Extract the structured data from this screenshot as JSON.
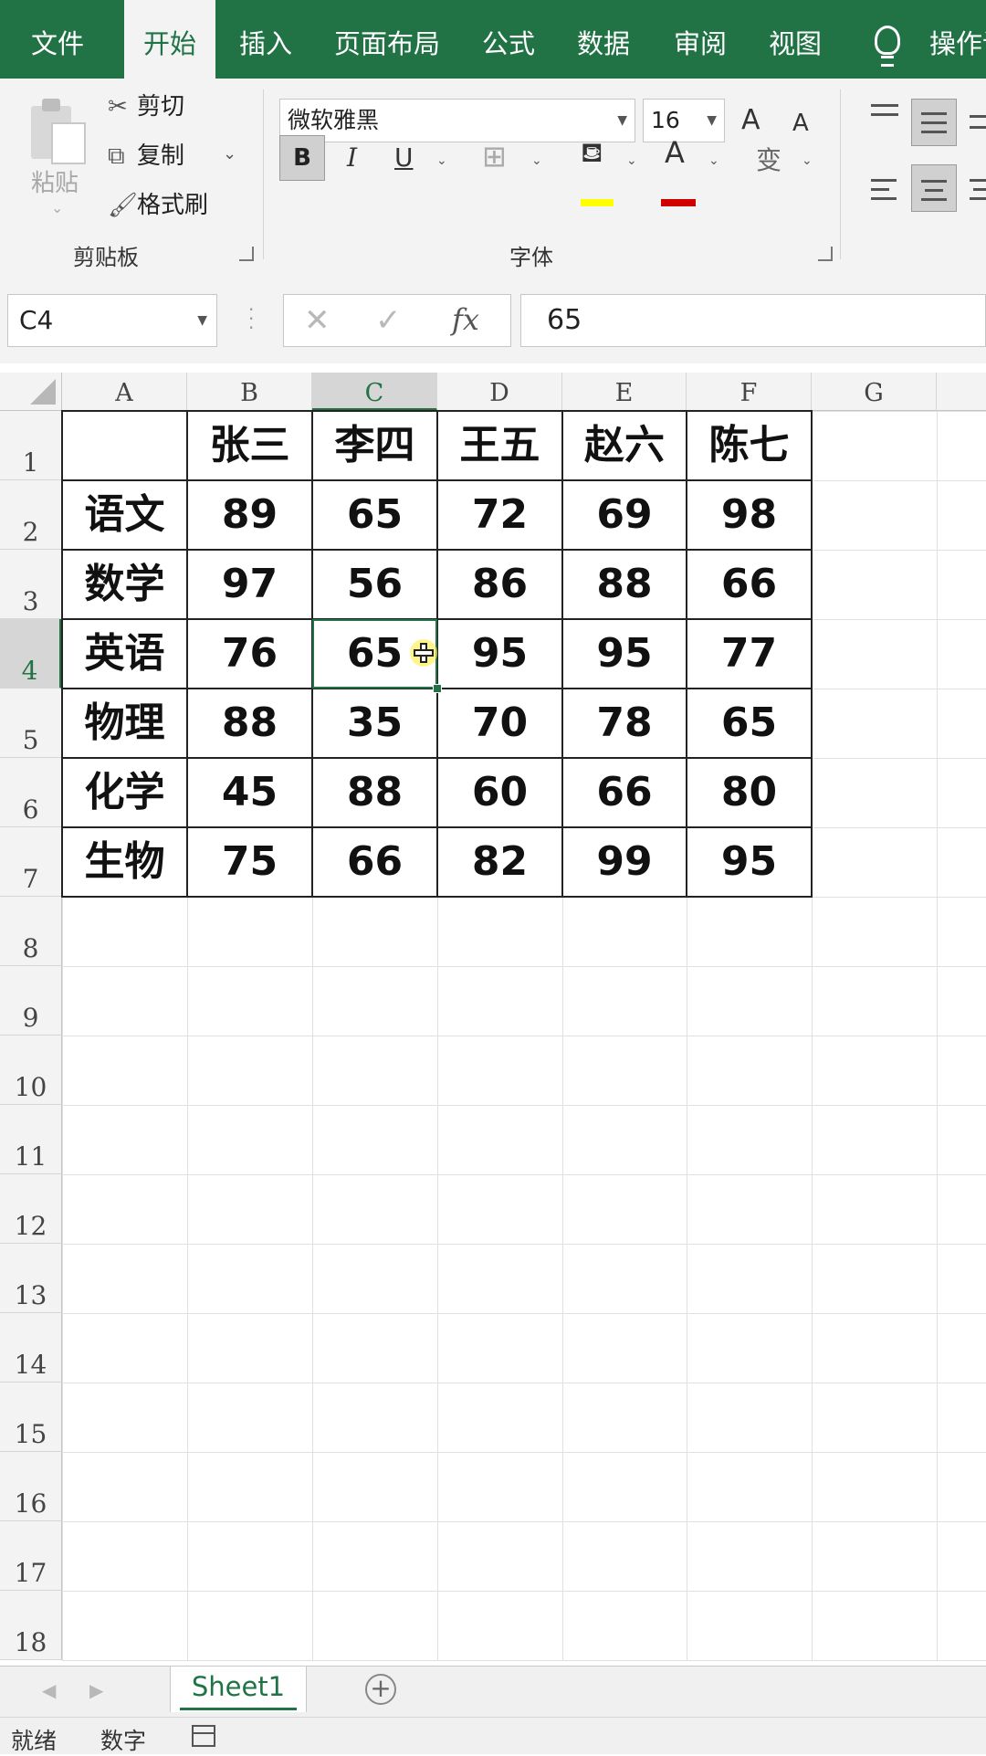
{
  "tabs": [
    "文件",
    "开始",
    "插入",
    "页面布局",
    "公式",
    "数据",
    "审阅",
    "视图"
  ],
  "active_tab": "开始",
  "tell_me": "操作说",
  "clipboard": {
    "paste": "粘贴",
    "cut": "剪切",
    "copy": "复制",
    "format_painter": "格式刷",
    "group_label": "剪贴板"
  },
  "font": {
    "name": "微软雅黑",
    "size": "16",
    "group_label": "字体",
    "bold": "B",
    "italic": "I",
    "underline": "U",
    "grow": "A",
    "shrink": "A",
    "font_color_glyph": "A",
    "phonetic": "变"
  },
  "formula_bar": {
    "name_box": "C4",
    "fx": "fx",
    "content": "65"
  },
  "columns": [
    "A",
    "B",
    "C",
    "D",
    "E",
    "F",
    "G"
  ],
  "selected_column": "C",
  "rows": [
    "1",
    "2",
    "3",
    "4",
    "5",
    "6",
    "7",
    "8",
    "9",
    "10",
    "11",
    "12",
    "13",
    "14",
    "15",
    "16",
    "17",
    "18"
  ],
  "selected_row": "4",
  "table": {
    "header": [
      "",
      "张三",
      "李四",
      "王五",
      "赵六",
      "陈七"
    ],
    "body": [
      [
        "语文",
        "89",
        "65",
        "72",
        "69",
        "98"
      ],
      [
        "数学",
        "97",
        "56",
        "86",
        "88",
        "66"
      ],
      [
        "英语",
        "76",
        "65",
        "95",
        "95",
        "77"
      ],
      [
        "物理",
        "88",
        "35",
        "70",
        "78",
        "65"
      ],
      [
        "化学",
        "45",
        "88",
        "60",
        "66",
        "80"
      ],
      [
        "生物",
        "75",
        "66",
        "82",
        "99",
        "95"
      ]
    ]
  },
  "sheet_tab": "Sheet1",
  "status": {
    "ready": "就绪",
    "mode": "数字"
  },
  "colors": {
    "accent": "#217346",
    "fill_color": "#ffff00",
    "font_color": "#d00000"
  }
}
